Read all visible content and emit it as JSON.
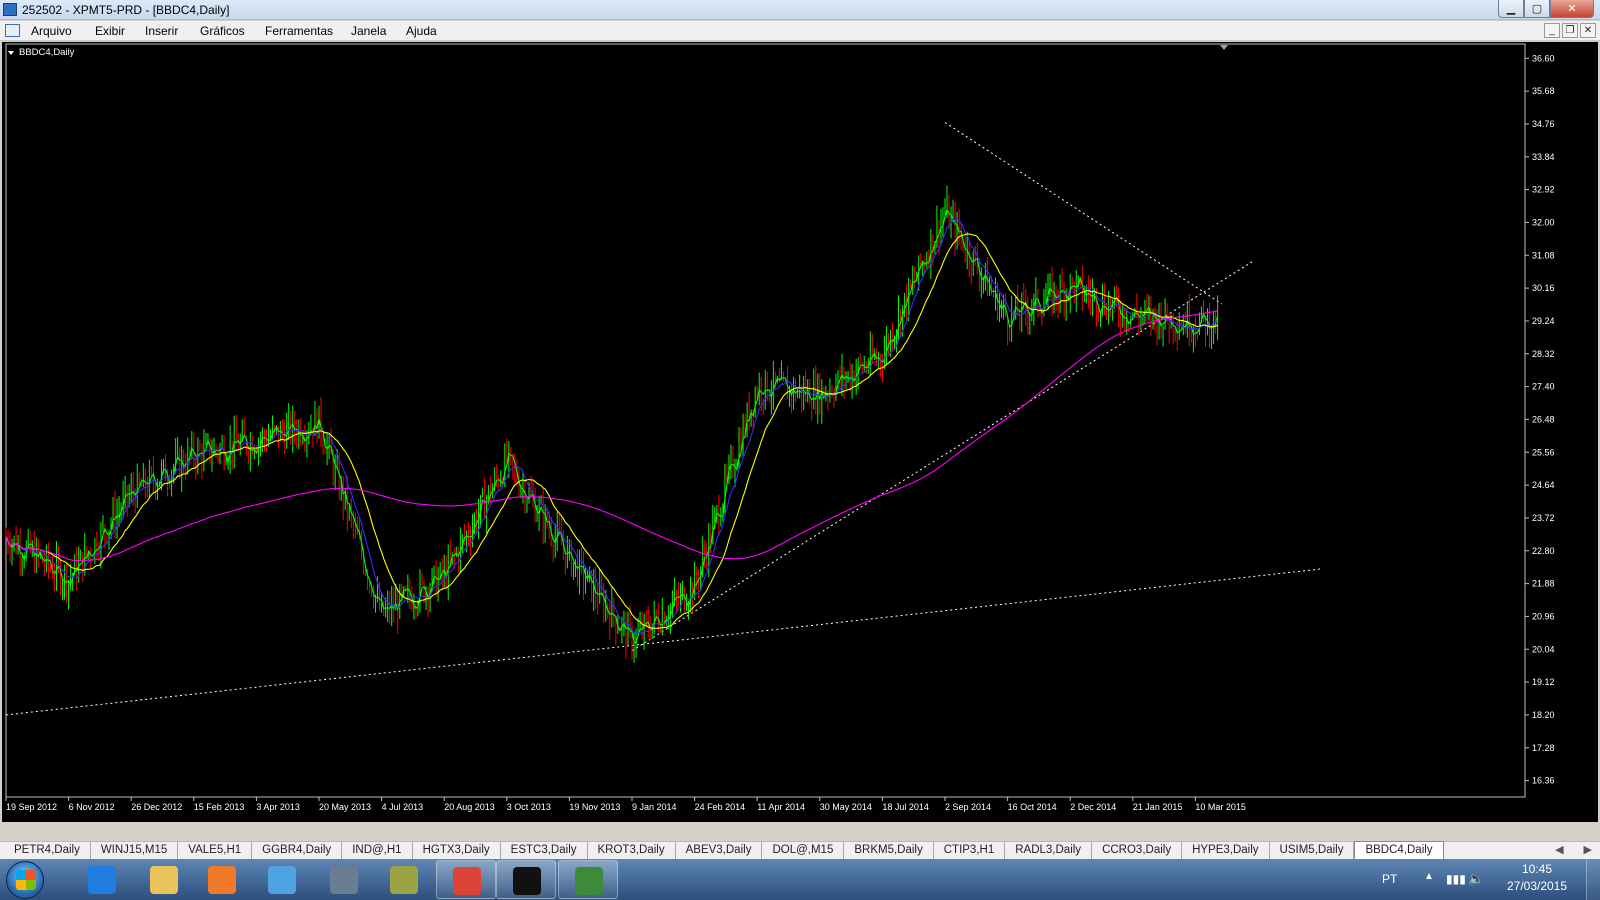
{
  "window": {
    "title": "252502 - XPMT5-PRD - [BBDC4,Daily]",
    "buttons": {
      "minimize": "▁",
      "maximize": "▢",
      "close": "✕"
    }
  },
  "menu": {
    "items": [
      "Arquivo",
      "Exibir",
      "Inserir",
      "Gráficos",
      "Ferramentas",
      "Janela",
      "Ajuda"
    ],
    "mdi_buttons": [
      "_",
      "❐",
      "✕"
    ]
  },
  "chart": {
    "label": "BBDC4,Daily",
    "colors": {
      "background": "#000000",
      "up_candle": "#00ff00",
      "down_candle": "#ff0000",
      "ma_fast": "#00ff00",
      "ma_blue": "#3030ff",
      "ma_yellow": "#ffff00",
      "ma_slow": "#ff00ff",
      "trendline": "#ffffff",
      "axis_text": "#ffffff"
    }
  },
  "chart_data": {
    "type": "candlestick",
    "title": "BBDC4,Daily",
    "xlabel": "",
    "ylabel": "",
    "ylim": [
      15.9,
      37.0
    ],
    "y_ticks": [
      "36.60",
      "35.68",
      "34.76",
      "33.84",
      "32.92",
      "32.00",
      "31.08",
      "30.16",
      "29.24",
      "28.32",
      "27.40",
      "26.48",
      "25.56",
      "24.64",
      "23.72",
      "22.80",
      "21.88",
      "20.96",
      "20.04",
      "19.12",
      "18.20",
      "17.28",
      "16.36"
    ],
    "x_ticks": [
      "19 Sep 2012",
      "6 Nov 2012",
      "26 Dec 2012",
      "15 Feb 2013",
      "3 Apr 2013",
      "20 May 2013",
      "4 Jul 2013",
      "20 Aug 2013",
      "3 Oct 2013",
      "19 Nov 2013",
      "9 Jan 2014",
      "24 Feb 2014",
      "11 Apr 2014",
      "30 May 2014",
      "18 Jul 2014",
      "2 Sep 2014",
      "16 Oct 2014",
      "2 Dec 2014",
      "21 Jan 2015",
      "10 Mar 2015"
    ],
    "price_path": [
      {
        "date": "19 Sep 2012",
        "close": 23.2
      },
      {
        "date": "6 Nov 2012",
        "close": 22.0
      },
      {
        "date": "26 Dec 2012",
        "close": 24.4
      },
      {
        "date": "15 Feb 2013",
        "close": 25.5
      },
      {
        "date": "3 Apr 2013",
        "close": 25.9
      },
      {
        "date": "20 May 2013",
        "close": 26.4
      },
      {
        "date": "4 Jul 2013",
        "close": 21.0
      },
      {
        "date": "20 Aug 2013",
        "close": 22.1
      },
      {
        "date": "3 Oct 2013",
        "close": 25.3
      },
      {
        "date": "19 Nov 2013",
        "close": 22.6
      },
      {
        "date": "9 Jan 2014",
        "close": 20.3
      },
      {
        "date": "24 Feb 2014",
        "close": 21.8
      },
      {
        "date": "11 Apr 2014",
        "close": 27.4
      },
      {
        "date": "30 May 2014",
        "close": 27.2
      },
      {
        "date": "18 Jul 2014",
        "close": 28.3
      },
      {
        "date": "2 Sep 2014",
        "close": 32.3
      },
      {
        "date": "16 Oct 2014",
        "close": 29.3
      },
      {
        "date": "2 Dec 2014",
        "close": 30.2
      },
      {
        "date": "21 Jan 2015",
        "close": 29.4
      },
      {
        "date": "10 Mar 2015",
        "close": 29.2
      }
    ],
    "series": [
      {
        "name": "",
        "color": "#00ff00",
        "style": "moving-average-fast"
      },
      {
        "name": "",
        "color": "#3030ff",
        "style": "moving-average"
      },
      {
        "name": "",
        "color": "#ffff00",
        "style": "moving-average"
      },
      {
        "name": "",
        "color": "#ff00ff",
        "style": "moving-average-slow"
      }
    ],
    "trendlines": [
      {
        "from": {
          "date": "19 Sep 2012",
          "price": 18.2
        },
        "to": {
          "date": "10 Mar 2015",
          "price": 21.9
        }
      },
      {
        "from": {
          "date": "9 Jan 2014",
          "price": 20.0
        },
        "to": {
          "date": "10 Mar 2015",
          "price": 29.9
        }
      },
      {
        "from": {
          "date": "2 Sep 2014",
          "price": 34.8
        },
        "to": {
          "date": "10 Mar 2015",
          "price": 30.2
        }
      }
    ]
  },
  "tabs": {
    "items": [
      "PETR4,Daily",
      "WINJ15,M15",
      "VALE5,H1",
      "GGBR4,Daily",
      "IND@,H1",
      "HGTX3,Daily",
      "ESTC3,Daily",
      "KROT3,Daily",
      "ABEV3,Daily",
      "DOL@,M15",
      "BRKM5,Daily",
      "CTIP3,H1",
      "RADL3,Daily",
      "CCRO3,Daily",
      "HYPE3,Daily",
      "USIM5,Daily",
      "BBDC4,Daily"
    ],
    "active": "BBDC4,Daily",
    "scroll_left": "◀",
    "scroll_right": "▶"
  },
  "taskbar": {
    "buttons": [
      {
        "name": "internet-explorer-icon",
        "color": "#1f7de0",
        "state": "pinned"
      },
      {
        "name": "windows-explorer-icon",
        "color": "#e8c25a",
        "state": "pinned"
      },
      {
        "name": "media-player-icon",
        "color": "#f07a2a",
        "state": "pinned"
      },
      {
        "name": "remote-desktop-icon",
        "color": "#4fa3e3",
        "state": "pinned"
      },
      {
        "name": "hp-icon",
        "color": "#6b7d92",
        "state": "pinned"
      },
      {
        "name": "server-manager-icon",
        "color": "#9ba345",
        "state": "pinned"
      },
      {
        "name": "chrome-icon",
        "color": "#db4437",
        "state": "open"
      },
      {
        "name": "xp-investimentos-icon",
        "color": "#111111",
        "state": "open"
      },
      {
        "name": "metatrader-icon",
        "color": "#3f8a3a",
        "state": "open"
      }
    ],
    "tray": {
      "language": "PT",
      "arrow": "▲",
      "signal": "▮▮▮",
      "speaker": "🔈",
      "time": "10:45",
      "date": "27/03/2015"
    }
  }
}
